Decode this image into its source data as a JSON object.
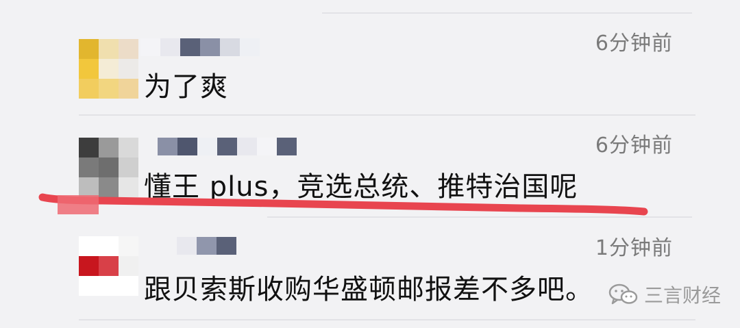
{
  "comments": [
    {
      "time": "6分钟前",
      "text": "为了爽"
    },
    {
      "time": "6分钟前",
      "text": "懂王 plus，竞选总统、推特治国呢"
    },
    {
      "time": "1分钟前",
      "text": "跟贝索斯收购华盛顿邮报差不多吧。"
    }
  ],
  "watermark": {
    "label": "三言财经",
    "icon": "wechat-icon"
  },
  "colors": {
    "background": "#f2f2f4",
    "divider": "#e2e2e6",
    "text": "#111111",
    "time": "#7a7a7a",
    "highlight": "#e8454f"
  }
}
